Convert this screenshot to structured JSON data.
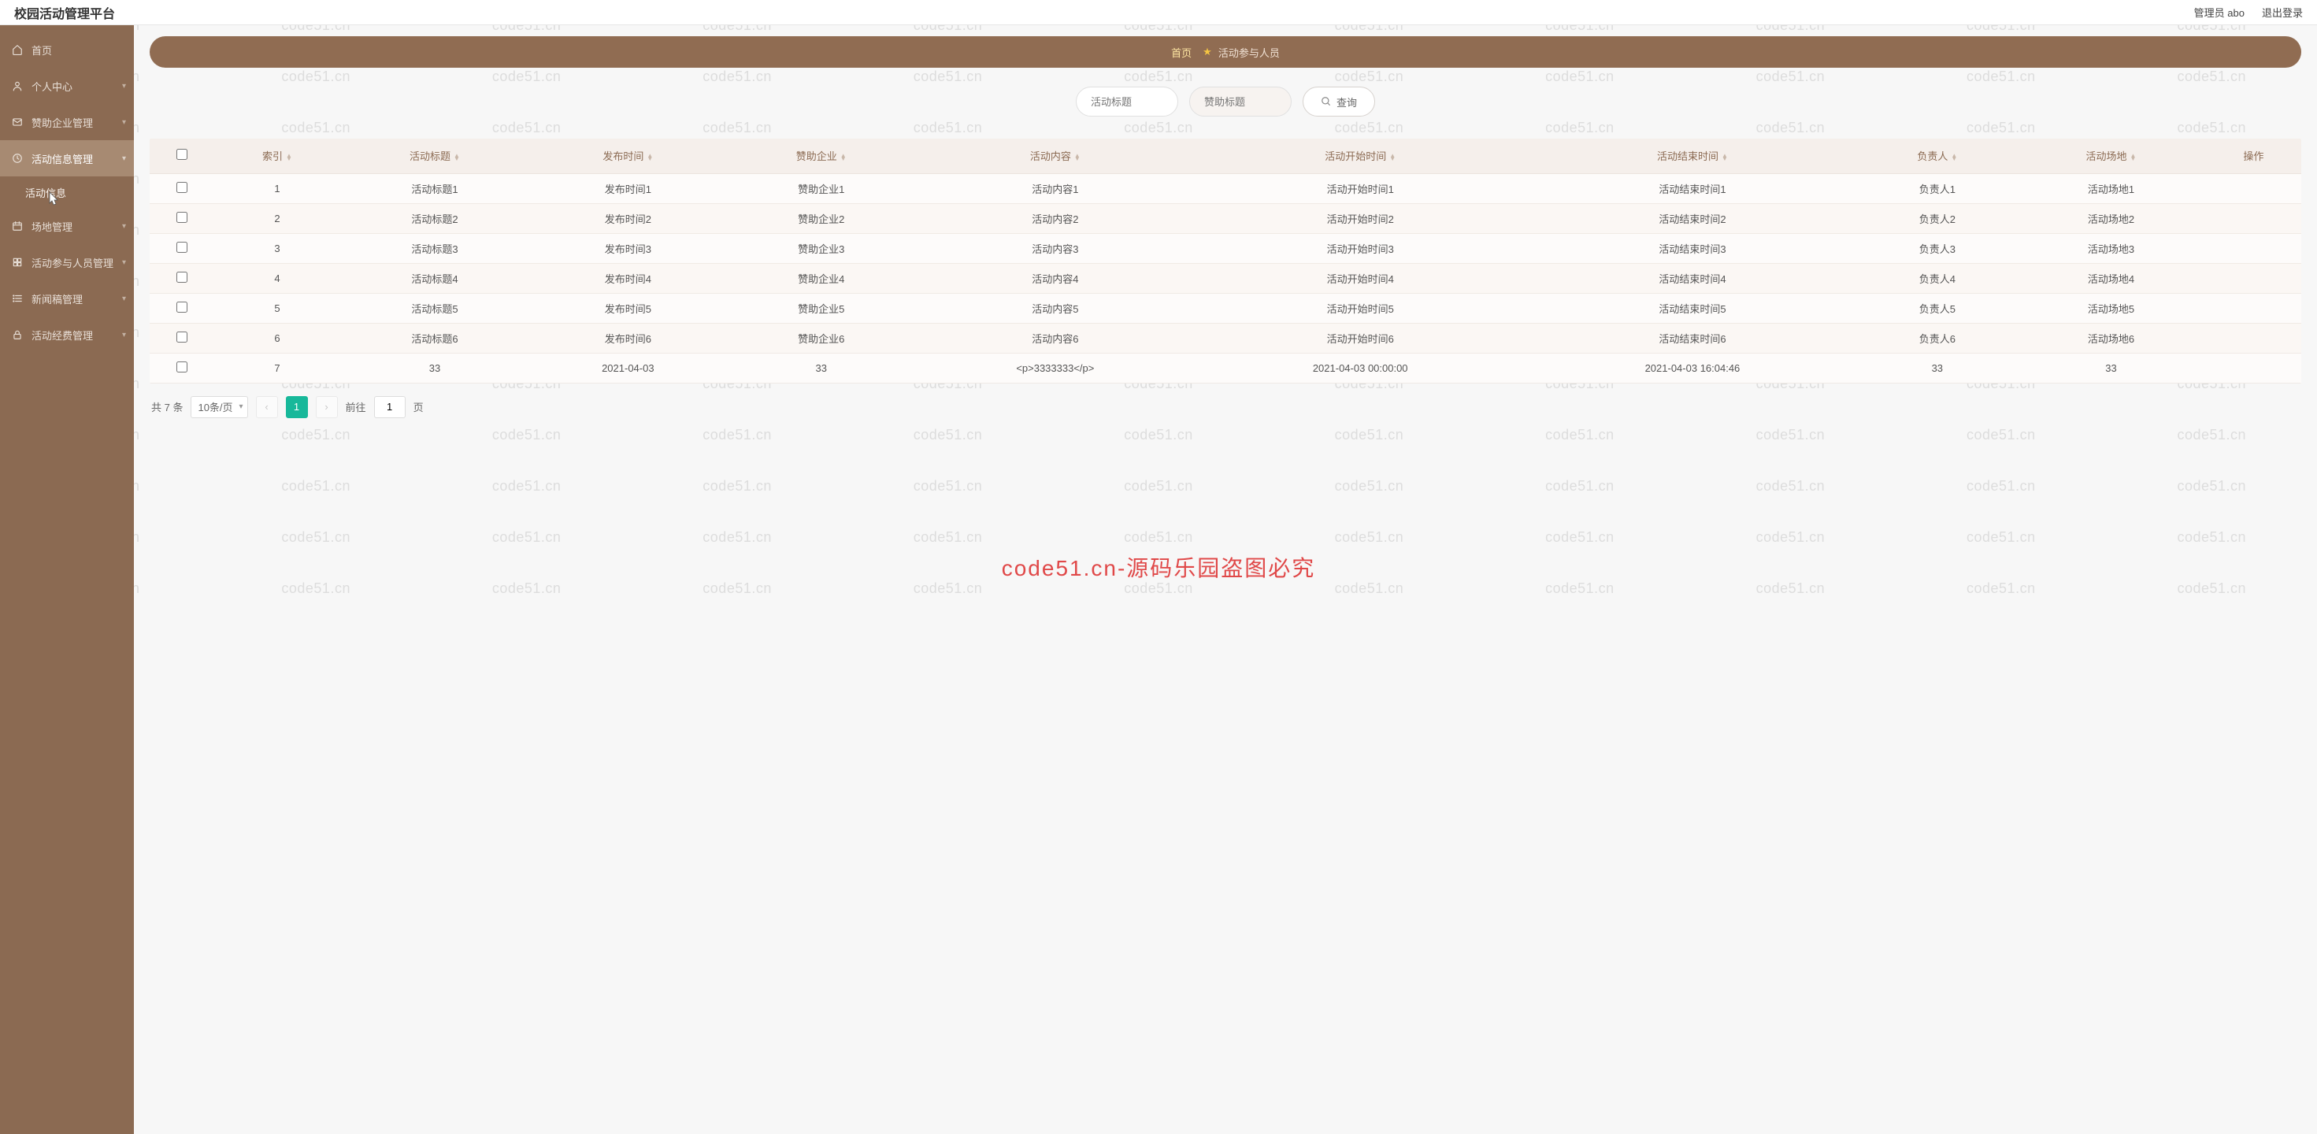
{
  "watermark_text": "code51.cn",
  "center_watermark": "code51.cn-源码乐园盗图必究",
  "header": {
    "title": "校园活动管理平台",
    "user_label": "管理员 abo",
    "logout_label": "退出登录"
  },
  "sidebar": {
    "items": [
      {
        "icon": "home",
        "label": "首页"
      },
      {
        "icon": "user",
        "label": "个人中心",
        "chevron": true
      },
      {
        "icon": "mail",
        "label": "赞助企业管理",
        "chevron": true
      },
      {
        "icon": "clock",
        "label": "活动信息管理",
        "chevron": true,
        "active_parent": true,
        "children": [
          {
            "label": "活动信息"
          }
        ]
      },
      {
        "icon": "calendar",
        "label": "场地管理",
        "chevron": true
      },
      {
        "icon": "grid",
        "label": "活动参与人员管理",
        "chevron": true
      },
      {
        "icon": "list",
        "label": "新闻稿管理",
        "chevron": true
      },
      {
        "icon": "lock",
        "label": "活动经费管理",
        "chevron": true
      }
    ]
  },
  "breadcrumb": {
    "home": "首页",
    "current": "活动参与人员"
  },
  "filter": {
    "placeholder1": "活动标题",
    "placeholder2": "赞助标题",
    "search_label": "查询"
  },
  "table": {
    "columns": [
      "索引",
      "活动标题",
      "发布时间",
      "赞助企业",
      "活动内容",
      "活动开始时间",
      "活动结束时间",
      "负责人",
      "活动场地",
      "操作"
    ],
    "rows": [
      {
        "idx": "1",
        "title": "活动标题1",
        "pub": "发布时间1",
        "sponsor": "赞助企业1",
        "content": "活动内容1",
        "start": "活动开始时间1",
        "end": "活动结束时间1",
        "owner": "负责人1",
        "venue": "活动场地1"
      },
      {
        "idx": "2",
        "title": "活动标题2",
        "pub": "发布时间2",
        "sponsor": "赞助企业2",
        "content": "活动内容2",
        "start": "活动开始时间2",
        "end": "活动结束时间2",
        "owner": "负责人2",
        "venue": "活动场地2"
      },
      {
        "idx": "3",
        "title": "活动标题3",
        "pub": "发布时间3",
        "sponsor": "赞助企业3",
        "content": "活动内容3",
        "start": "活动开始时间3",
        "end": "活动结束时间3",
        "owner": "负责人3",
        "venue": "活动场地3"
      },
      {
        "idx": "4",
        "title": "活动标题4",
        "pub": "发布时间4",
        "sponsor": "赞助企业4",
        "content": "活动内容4",
        "start": "活动开始时间4",
        "end": "活动结束时间4",
        "owner": "负责人4",
        "venue": "活动场地4"
      },
      {
        "idx": "5",
        "title": "活动标题5",
        "pub": "发布时间5",
        "sponsor": "赞助企业5",
        "content": "活动内容5",
        "start": "活动开始时间5",
        "end": "活动结束时间5",
        "owner": "负责人5",
        "venue": "活动场地5"
      },
      {
        "idx": "6",
        "title": "活动标题6",
        "pub": "发布时间6",
        "sponsor": "赞助企业6",
        "content": "活动内容6",
        "start": "活动开始时间6",
        "end": "活动结束时间6",
        "owner": "负责人6",
        "venue": "活动场地6"
      },
      {
        "idx": "7",
        "title": "33",
        "pub": "2021-04-03",
        "sponsor": "33",
        "content": "<p>3333333</p>",
        "start": "2021-04-03 00:00:00",
        "end": "2021-04-03 16:04:46",
        "owner": "33",
        "venue": "33"
      }
    ]
  },
  "pagination": {
    "total_label": "共 7 条",
    "page_size_label": "10条/页",
    "current_page": "1",
    "goto_prefix": "前往",
    "goto_value": "1",
    "goto_suffix": "页"
  }
}
